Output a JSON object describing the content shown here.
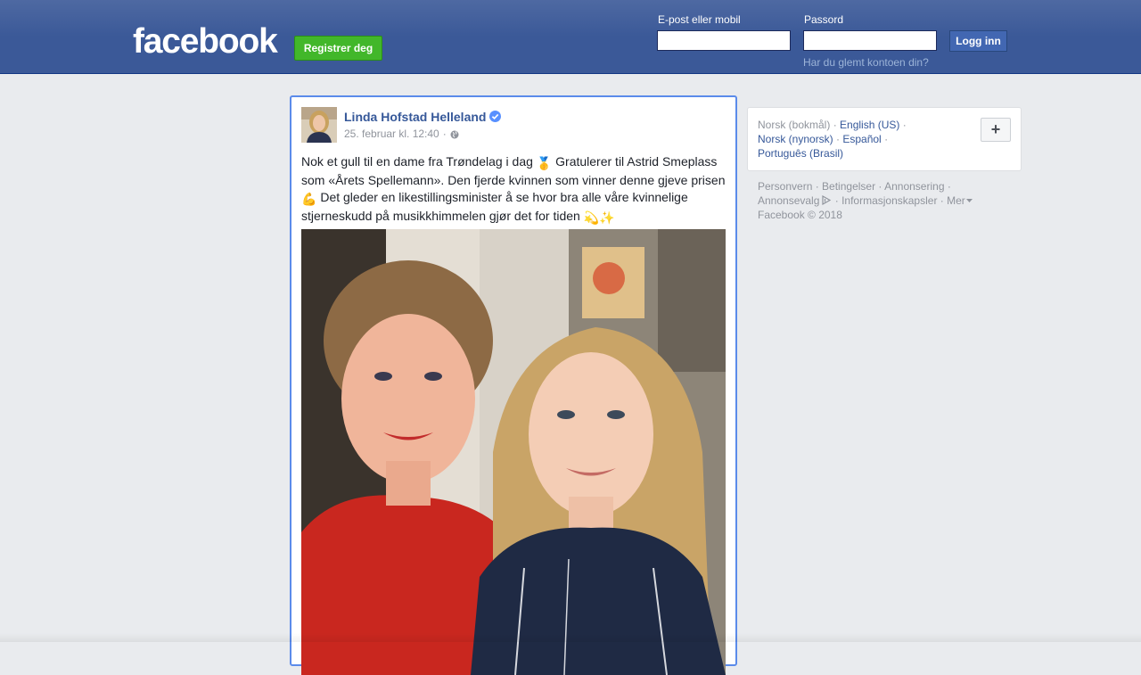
{
  "header": {
    "logo_text": "facebook",
    "register_label": "Registrer deg",
    "email_label": "E-post eller mobil",
    "email_value": "",
    "password_label": "Passord",
    "password_value": "",
    "login_label": "Logg inn",
    "forgot_label": "Har du glemt kontoen din?",
    "colors": {
      "bar": "#3b5998",
      "register": "#42b72a",
      "login": "#4267b2"
    }
  },
  "post": {
    "author": "Linda Hofstad Helleland",
    "verified_icon": "verified-badge-icon",
    "timestamp": "25. februar kl. 12:40",
    "separator": "·",
    "audience_icon": "globe-icon",
    "text_part1": "Nok et gull til en dame fra Trøndelag i dag ",
    "emoji1": "🥇",
    "text_part2": " Gratulerer til Astrid Smeplass som «Årets Spellemann». Den fjerde kvinnen som vinner denne gjeve prisen ",
    "emoji2": "💪",
    "text_part3": " Det gleder en likestillingsminister å se hvor bra alle våre kvinnelige stjerneskudd på musikkhimmelen gjør det for tiden ",
    "emoji3": "💫✨"
  },
  "languages": {
    "current": "Norsk (bokmål)",
    "options": [
      "English (US)",
      "Norsk (nynorsk)",
      "Español",
      "Português (Brasil)"
    ],
    "more_label": "+"
  },
  "footer": {
    "links": [
      "Personvern",
      "Betingelser",
      "Annonsering",
      "Annonsevalg",
      "Informasjonskapsler",
      "Mer"
    ],
    "adchoices_icon": "adchoices-icon",
    "dropdown_icon": "caret-down-icon",
    "copyright": "Facebook © 2018"
  }
}
